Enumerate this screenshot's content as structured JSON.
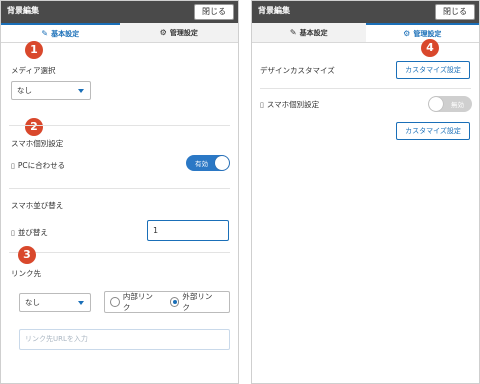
{
  "left": {
    "title": "背景編集",
    "close_label": "閉じる",
    "tabs": [
      {
        "label": "基本設定",
        "icon": "edit-icon",
        "glyph": "✎"
      },
      {
        "label": "管理設定",
        "icon": "gear-icon",
        "glyph": "⚙"
      }
    ],
    "badges": [
      "1",
      "2",
      "3"
    ],
    "media_label": "メディア選択",
    "media_value": "なし",
    "sp_individual_label": "スマホ個別設定",
    "fit_pc_label": "PCに合わせる",
    "fit_pc_toggle": "有効",
    "sp_sort_label": "スマホ並び替え",
    "sort_label": "並び替え",
    "sort_value": "1",
    "link_label": "リンク先",
    "link_select_value": "なし",
    "radio_internal": "内部リンク",
    "radio_external": "外部リンク",
    "url_placeholder": "リンク先URLを入力"
  },
  "right": {
    "title": "背景編集",
    "close_label": "閉じる",
    "tabs": [
      {
        "label": "基本設定",
        "icon": "edit-icon",
        "glyph": "✎"
      },
      {
        "label": "管理設定",
        "icon": "gear-icon",
        "glyph": "⚙"
      }
    ],
    "badge": "4",
    "design_customize_label": "デザインカスタマイズ",
    "customize_button": "カスタマイズ設定",
    "sp_individual_label": "スマホ個別設定",
    "sp_toggle": "無効",
    "customize_button_2": "カスタマイズ設定"
  },
  "colors": {
    "accent": "#1a6fb8",
    "badge": "#d9482c",
    "titlebar": "#4a4a4a",
    "toggle_on": "#2b78c5",
    "toggle_off": "#cfcfcf"
  }
}
